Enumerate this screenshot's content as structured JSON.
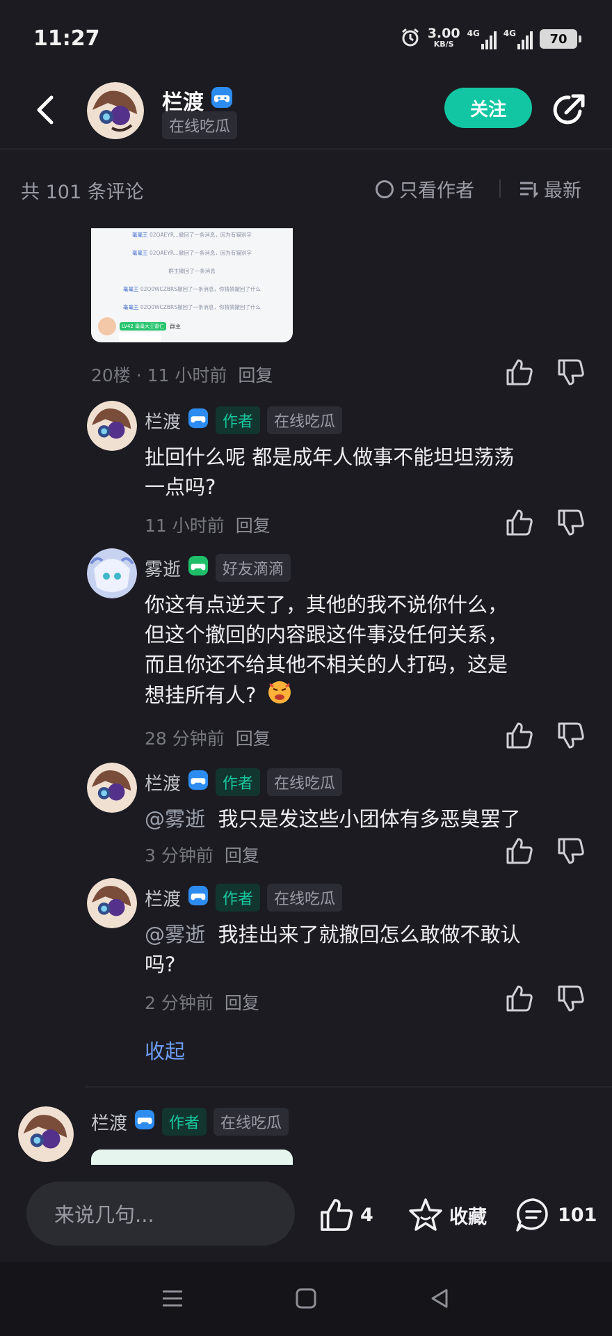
{
  "status_bar": {
    "time": "11:27",
    "net_speed": "3.00",
    "net_unit": "KB/S",
    "signal1": "4G",
    "signal2": "4G",
    "battery": "70"
  },
  "header": {
    "username": "栏渡",
    "tag": "在线吃瓜",
    "follow_label": "关注"
  },
  "toolbar": {
    "comment_count": "共 101 条评论",
    "author_only": "只看作者",
    "sort_label": "最新"
  },
  "embed": {
    "lines": [
      {
        "name": "毫毫王",
        "text": "02QAEYR...撤回了一条消息，因为有猫别字"
      },
      {
        "name": "毫毫王",
        "text": "02QAEYR...撤回了一条消息，因为有猫别字"
      },
      {
        "name": "",
        "text": "群主撤回了一条消息"
      },
      {
        "name": "毫毫王",
        "text": "02Q0WCZBRS撤回了一条消息，你猜猜撤回了什么"
      },
      {
        "name": "毫毫王",
        "text": "02Q0WCZBRS撤回了一条消息，你猜猜撤回了什么"
      }
    ],
    "level_badge": "LV42 毫毫大王雷仁",
    "sender": "群主"
  },
  "main_comment": {
    "meta": "20楼 · 11 小时前",
    "reply": "回复"
  },
  "replies": [
    {
      "name": "栏渡",
      "author_badge": "作者",
      "tag": "在线吃瓜",
      "mention": "",
      "text_lines": [
        "扯回什么呢 都是成年人做事不能坦坦荡荡",
        "一点吗?"
      ],
      "time": "11 小时前",
      "reply": "回复"
    },
    {
      "name": "雾逝",
      "author_badge": "",
      "tag": "好友滴滴",
      "mention": "",
      "text_lines": [
        "你这有点逆天了，其他的我不说你什么，",
        "但这个撤回的内容跟这件事没任何关系，",
        "而且你还不给其他不相关的人打码，这是",
        "想挂所有人?"
      ],
      "time": "28 分钟前",
      "reply": "回复"
    },
    {
      "name": "栏渡",
      "author_badge": "作者",
      "tag": "在线吃瓜",
      "mention": "@雾逝",
      "text_lines": [
        "我只是发这些小团体有多恶臭罢了"
      ],
      "time": "3 分钟前",
      "reply": "回复"
    },
    {
      "name": "栏渡",
      "author_badge": "作者",
      "tag": "在线吃瓜",
      "mention": "@雾逝",
      "text_lines": [
        "我挂出来了就撤回怎么敢做不敢认",
        "吗?"
      ],
      "time": "2 分钟前",
      "reply": "回复"
    }
  ],
  "collapse_label": "收起",
  "next_comment": {
    "name": "栏渡",
    "author_badge": "作者",
    "tag": "在线吃瓜"
  },
  "bottom_bar": {
    "input_placeholder": "来说几句...",
    "like_count": "4",
    "favorite_label": "收藏",
    "comment_count": "101"
  },
  "colors": {
    "background": "#1b1b21",
    "accent": "#13c6a3",
    "link": "#6c9cf6"
  }
}
